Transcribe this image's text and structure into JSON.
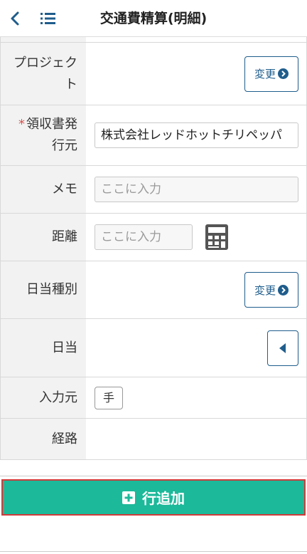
{
  "header": {
    "title": "交通費精算(明細)",
    "back_icon": "chevron-left-icon",
    "menu_icon": "list-icon"
  },
  "rows": {
    "project": {
      "label_line1": "プロジェク",
      "label_line2": "ト",
      "button": "変更"
    },
    "issuer": {
      "required_mark": "*",
      "label_line1": "領収書発",
      "label_line2": "行元",
      "value": "株式会社レッドホットチリペッパ"
    },
    "memo": {
      "label": "メモ",
      "placeholder": "ここに入力"
    },
    "distance": {
      "label": "距離",
      "placeholder": "ここに入力",
      "calculator_icon": "calculator-icon"
    },
    "allowance_type": {
      "label": "日当種別",
      "button": "変更"
    },
    "allowance": {
      "label": "日当",
      "toggle_icon": "caret-left-icon"
    },
    "input_source": {
      "label": "入力元",
      "badge": "手"
    },
    "route": {
      "label": "経路"
    }
  },
  "footer": {
    "add_row_label": "行追加",
    "add_icon": "plus-square-icon"
  },
  "colors": {
    "accent_green": "#1cb99a",
    "button_blue": "#1f5d8c",
    "highlight_red": "#d23a3a",
    "required_red": "#d9534f"
  }
}
